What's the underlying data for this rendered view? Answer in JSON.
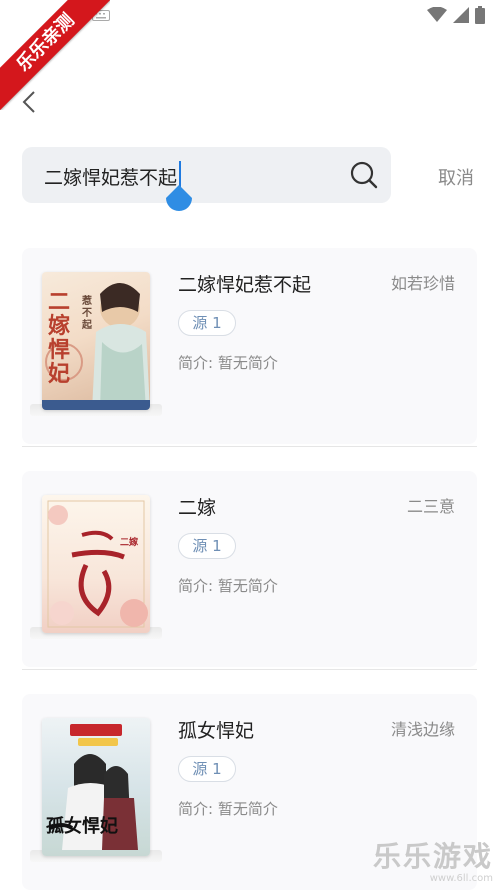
{
  "ribbon": {
    "text": "乐乐亲测"
  },
  "search": {
    "query": "二嫁悍妃惹不起",
    "cancel_label": "取消"
  },
  "results": [
    {
      "title": "二嫁悍妃惹不起",
      "author": "如若珍惜",
      "source": "源 1",
      "intro": "简介: 暂无简介",
      "cover_title": "二嫁悍妃",
      "cover_subtitle": "惹不起",
      "cover_colors": [
        "#f6e6d2",
        "#c9543c"
      ]
    },
    {
      "title": "二嫁",
      "author": "二三意",
      "source": "源 1",
      "intro": "简介: 暂无简介",
      "cover_title": "二嫁",
      "cover_colors": [
        "#fbf1e4",
        "#a8232a"
      ]
    },
    {
      "title": "孤女悍妃",
      "author": "清浅边缘",
      "source": "源 1",
      "intro": "简介: 暂无简介",
      "cover_title": "孤女悍妃",
      "cover_colors": [
        "#dfe8ec",
        "#1a1a1a"
      ]
    }
  ],
  "watermark": {
    "title": "乐乐游戏",
    "url": "www.6ll.com"
  }
}
